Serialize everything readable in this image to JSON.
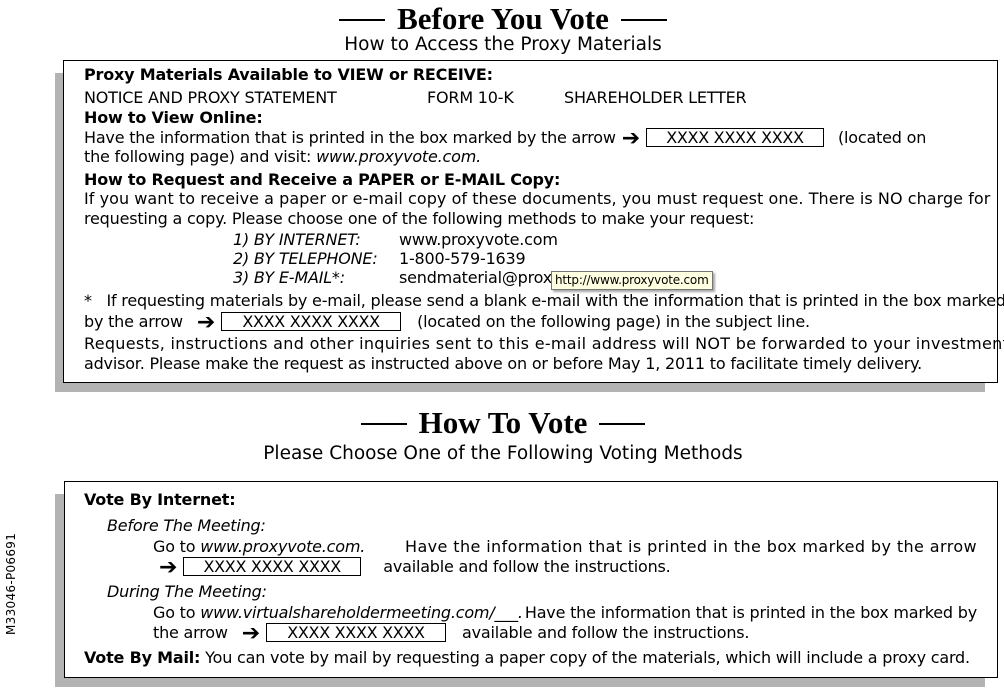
{
  "section1": {
    "title": "Before You Vote",
    "subtitle": "How to Access the Proxy Materials",
    "materials_heading": "Proxy Materials Available to VIEW or RECEIVE:",
    "materials": [
      "NOTICE AND PROXY STATEMENT",
      "FORM 10-K",
      "SHAREHOLDER LETTER"
    ],
    "view_online_heading": "How to View Online:",
    "view_online_text_1": "Have the information that is printed in the box marked by the arrow",
    "view_online_text_2": "(located on",
    "view_online_text_3": "the following page) and visit:",
    "view_online_link": "www.proxyvote.com.",
    "control_number": "XXXX XXXX XXXX",
    "request_heading": "How to Request and Receive a PAPER or E-MAIL Copy:",
    "request_text_1": "If you want to receive a paper or e-mail copy of these documents, you must request one.  There is NO charge for",
    "request_text_2": "requesting a copy.  Please choose one of the following methods to make your request:",
    "methods": [
      {
        "label": "1) BY INTERNET:",
        "value": "www.proxyvote.com"
      },
      {
        "label": "2) BY TELEPHONE:",
        "value": "1-800-579-1639"
      },
      {
        "label": "3) BY E-MAIL*:",
        "value": "sendmaterial@proxyvote.com"
      }
    ],
    "footnote_1": "*   If requesting materials by e-mail, please send a blank e-mail with the information that is printed in the box marked",
    "footnote_2a": "by the arrow",
    "footnote_2b": "(located on the following page) in the subject line.",
    "notice_1": "Requests, instructions and other inquiries sent to this e-mail address will NOT be forwarded to your investment",
    "notice_2": "advisor.  Please make the request as instructed above on or before May 1, 2011 to facilitate timely delivery."
  },
  "tooltip": {
    "text": "http://www.proxyvote.com"
  },
  "section2": {
    "title": "How To Vote",
    "subtitle": "Please Choose One of the Following Voting Methods",
    "internet_heading": "Vote By Internet:",
    "before_label": "Before The Meeting:",
    "before_text_1a": "Go to",
    "before_link": "www.proxyvote.com.",
    "before_text_1b": "Have the information that is printed in the box marked by the arrow",
    "before_text_2": "available and follow the instructions.",
    "during_label": "During The Meeting:",
    "during_text_1a": "Go to",
    "during_link": "www.virtualshareholdermeeting.com/___.",
    "during_text_1b": "Have the information that is printed in the box marked by",
    "during_text_2a": "the arrow",
    "during_text_2b": "available and follow the instructions.",
    "control_number": "XXXX XXXX XXXX",
    "mail_heading": "Vote By Mail:",
    "mail_text": "You can vote by mail by requesting a paper copy of the materials, which will include a proxy card."
  },
  "side_code": "M33046-P06691"
}
